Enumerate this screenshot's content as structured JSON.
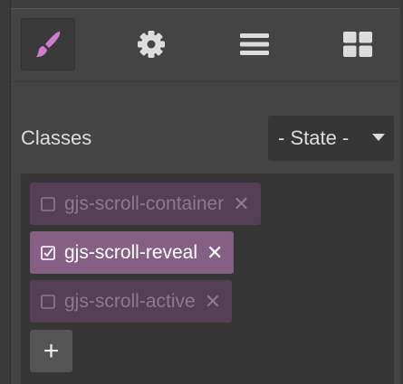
{
  "toolbar": {
    "buttons": [
      {
        "icon": "paint-brush-icon",
        "active": true
      },
      {
        "icon": "gear-icon",
        "active": false
      },
      {
        "icon": "bars-icon",
        "active": false
      },
      {
        "icon": "grid-icon",
        "active": false
      }
    ]
  },
  "selector": {
    "classes_label": "Classes",
    "state_label": "- State -"
  },
  "tags": [
    {
      "label": "gjs-scroll-container",
      "checked": false,
      "close": "✕"
    },
    {
      "label": "gjs-scroll-reveal",
      "checked": true,
      "close": "✕"
    },
    {
      "label": "gjs-scroll-active",
      "checked": false,
      "close": "✕"
    }
  ],
  "add_button": {
    "label": "+"
  },
  "colors": {
    "brush_accent": "#d07ad0",
    "tag_active_bg": "#865f85",
    "tag_inactive_bg": "#553f54"
  }
}
